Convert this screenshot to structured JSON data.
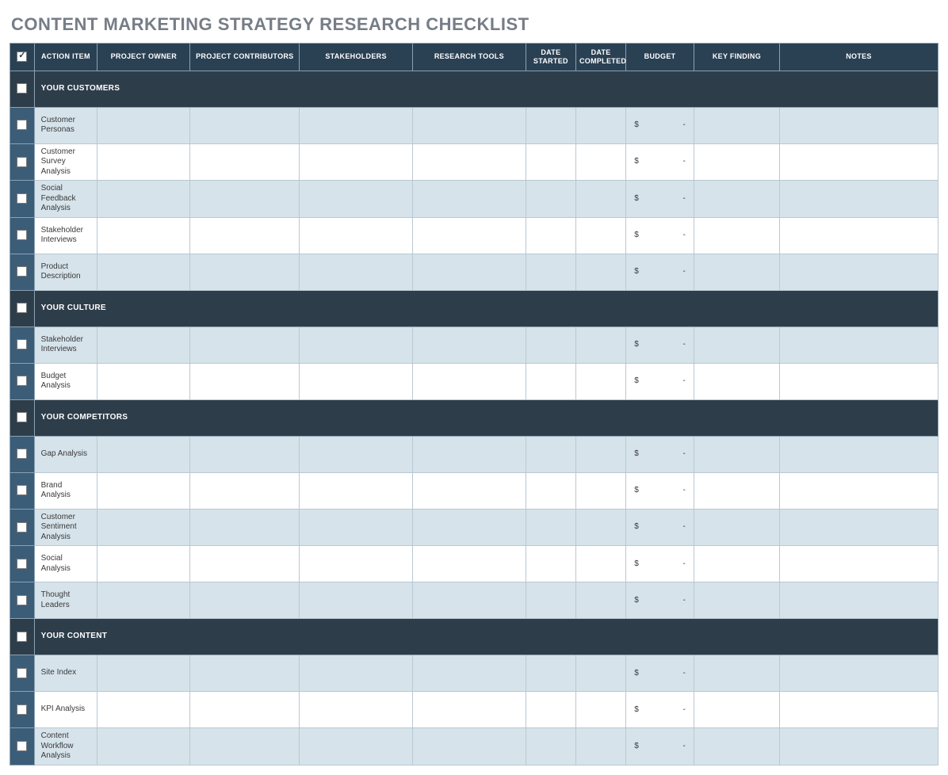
{
  "title": "CONTENT MARKETING STRATEGY RESEARCH CHECKLIST",
  "header_checked": true,
  "columns": {
    "action_item": "ACTION ITEM",
    "project_owner": "PROJECT OWNER",
    "project_contributors": "PROJECT  CONTRIBUTORS",
    "stakeholders": "STAKEHOLDERS",
    "research_tools": "RESEARCH TOOLS",
    "date_started": "DATE STARTED",
    "date_completed": "DATE COMPLETED",
    "budget": "BUDGET",
    "key_finding": "KEY FINDING",
    "notes": "NOTES"
  },
  "budget_symbol": "$",
  "budget_dash": "-",
  "sections": [
    {
      "label": "YOUR CUSTOMERS",
      "items": [
        {
          "action": "Customer Personas"
        },
        {
          "action": "Customer Survey Analysis"
        },
        {
          "action": "Social Feedback Analysis"
        },
        {
          "action": "Stakeholder Interviews"
        },
        {
          "action": "Product Description"
        }
      ]
    },
    {
      "label": "YOUR CULTURE",
      "items": [
        {
          "action": "Stakeholder Interviews"
        },
        {
          "action": "Budget Analysis"
        }
      ]
    },
    {
      "label": "YOUR COMPETITORS",
      "items": [
        {
          "action": "Gap Analysis"
        },
        {
          "action": "Brand Analysis"
        },
        {
          "action": "Customer Sentiment Analysis"
        },
        {
          "action": "Social Analysis"
        },
        {
          "action": "Thought Leaders"
        }
      ]
    },
    {
      "label": "YOUR CONTENT",
      "items": [
        {
          "action": "Site Index"
        },
        {
          "action": "KPI Analysis"
        },
        {
          "action": "Content Workflow Analysis"
        }
      ]
    }
  ]
}
